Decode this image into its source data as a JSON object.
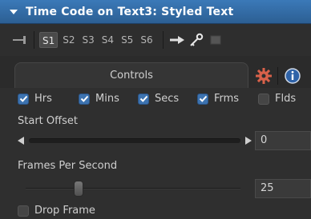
{
  "title": "Time Code on Text3: Styled Text",
  "toolbar": {
    "slots": [
      "S1",
      "S2",
      "S3",
      "S4",
      "S5",
      "S6"
    ],
    "active_slot": "S1"
  },
  "tabs": {
    "controls_label": "Controls",
    "gear_icon": "gear-icon",
    "info_icon": "info-icon"
  },
  "checks": [
    {
      "label": "Hrs",
      "checked": true
    },
    {
      "label": "Mins",
      "checked": true
    },
    {
      "label": "Secs",
      "checked": true
    },
    {
      "label": "Frms",
      "checked": true
    },
    {
      "label": "Flds",
      "checked": false
    }
  ],
  "start_offset": {
    "label": "Start Offset",
    "value": "0"
  },
  "fps": {
    "label": "Frames Per Second",
    "value": "25"
  },
  "drop_frame": {
    "label": "Drop Frame",
    "checked": false
  },
  "colors": {
    "accent": "#3d73b0",
    "titlebar": "#3b79b8"
  }
}
